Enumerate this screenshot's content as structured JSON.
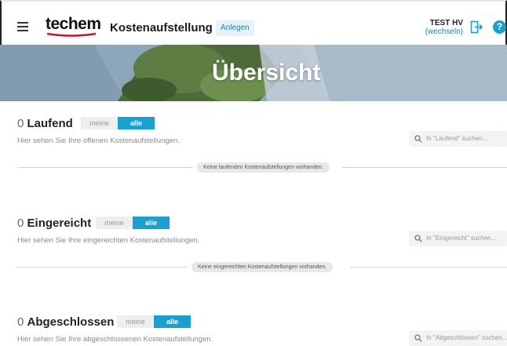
{
  "header": {
    "logo": "techem",
    "title": "Kostenaufstellung",
    "create_button": "Anlegen",
    "user_name": "TEST HV",
    "switch_link": "(wechseln)",
    "help_symbol": "?",
    "icons": {
      "menu": "hamburger-menu-icon",
      "logout": "logout-icon",
      "help": "help-icon"
    }
  },
  "hero": {
    "title": "Übersicht"
  },
  "sections": [
    {
      "count": "0",
      "title": "Laufend",
      "toggle_mine": "meine",
      "toggle_all": "alle",
      "description": "Hier sehen Sie Ihre offenen Kostenaufstellungen.",
      "search_placeholder": "In \"Laufend\" suchen...",
      "empty_message": "Keine laufenden Kostenaufstellungen vorhanden."
    },
    {
      "count": "0",
      "title": "Eingereicht",
      "toggle_mine": "meine",
      "toggle_all": "alle",
      "description": "Hier sehen Sie Ihre eingereichten Kostenaufstellungen.",
      "search_placeholder": "In \"Eingereicht\" suchen...",
      "empty_message": "Keine eingereichten Kostenaufstellungen vorhanden."
    },
    {
      "count": "0",
      "title": "Abgeschlossen",
      "toggle_mine": "meine",
      "toggle_all": "alle",
      "description": "Hier sehen Sie Ihre abgeschlossenen Kostenaufstellungen.",
      "search_placeholder": "In \"Abgeschlossen\" suchen..."
    }
  ],
  "colors": {
    "accent": "#1aa0cf",
    "link": "#1089b8",
    "logo_swoosh": "#c8102e"
  }
}
